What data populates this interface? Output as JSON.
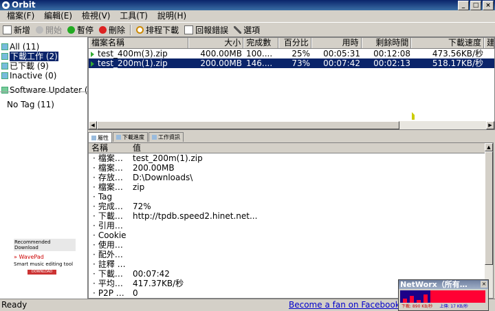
{
  "window": {
    "title": "Orbit"
  },
  "menu": [
    "檔案(F)",
    "編輯(E)",
    "檢視(V)",
    "工具(T)",
    "說明(H)"
  ],
  "toolbar": {
    "new": "新增",
    "start": "開始",
    "pause": "暫停",
    "delete": "刪除",
    "schedule": "排程下載",
    "report": "回報錯誤",
    "options": "選項"
  },
  "sidebar": {
    "items": [
      {
        "label": "All (11)"
      },
      {
        "label": "下載工作 (2)"
      },
      {
        "label": "已下載 (9)"
      },
      {
        "label": "Inactive (0)"
      }
    ],
    "updater": "Software Updater (0)",
    "notag": "No Tag (11)"
  },
  "ad": {
    "header": "Recommended Download",
    "name": "WavePad",
    "desc": "Smart music editing tool",
    "button": "DOWNLOAD"
  },
  "downloads": {
    "columns": [
      "檔案名稱",
      "大小",
      "完成數",
      "百分比",
      "用時",
      "剩餘時間",
      "下載速度",
      "建"
    ],
    "rows": [
      {
        "name": "test_400m(3).zip",
        "size": "400.00MB",
        "done": "100....",
        "pct": "25%",
        "elapsed": "00:05:31",
        "remaining": "00:12:08",
        "speed": "473.56KB/秒"
      },
      {
        "name": "test_200m(1).zip",
        "size": "200.00MB",
        "done": "146....",
        "pct": "73%",
        "elapsed": "00:07:42",
        "remaining": "00:02:13",
        "speed": "518.17KB/秒"
      }
    ]
  },
  "tabs": [
    "屬性",
    "下載進度",
    "工作資訊"
  ],
  "props": {
    "header": {
      "key": "名稱",
      "value": "值"
    },
    "rows": [
      {
        "k": "檔案…",
        "v": "test_200m(1).zip"
      },
      {
        "k": "檔案…",
        "v": "200.00MB"
      },
      {
        "k": "存放…",
        "v": "D:\\Downloads\\"
      },
      {
        "k": "檔案…",
        "v": "zip"
      },
      {
        "k": "Tag",
        "v": ""
      },
      {
        "k": "完成…",
        "v": "72%"
      },
      {
        "k": "下載…",
        "v": "http://tpdb.speed2.hinet.net..."
      },
      {
        "k": "引用…",
        "v": ""
      },
      {
        "k": "Cookie",
        "v": ""
      },
      {
        "k": "使用…",
        "v": ""
      },
      {
        "k": "配外…",
        "v": ""
      },
      {
        "k": "註釋 …",
        "v": ""
      },
      {
        "k": "下載…",
        "v": "00:07:42"
      },
      {
        "k": "平均…",
        "v": "417.37KB/秒"
      },
      {
        "k": "P2P …",
        "v": "0"
      }
    ]
  },
  "status": {
    "text": "Ready",
    "link": "Become a fan on Facebook"
  },
  "networx": {
    "title": "NetWorx（所有…",
    "down": "下載: 890 KB/秒",
    "up": "上傳: 17 KB/秒"
  }
}
